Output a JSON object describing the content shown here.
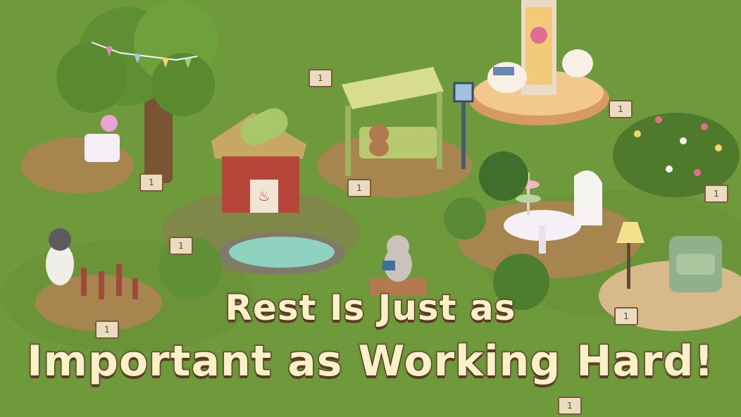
{
  "headline": {
    "line1": "Rest Is Just as",
    "line2": "Important as Working Hard!"
  },
  "signs": [
    "1",
    "1",
    "1",
    "1",
    "1",
    "1",
    "1",
    "1",
    "1"
  ],
  "colors": {
    "grass": "#6f9a3c",
    "dirt": "#a7854f",
    "text_fill": "#fbf1c8",
    "text_stroke": "#6b4a2e"
  }
}
